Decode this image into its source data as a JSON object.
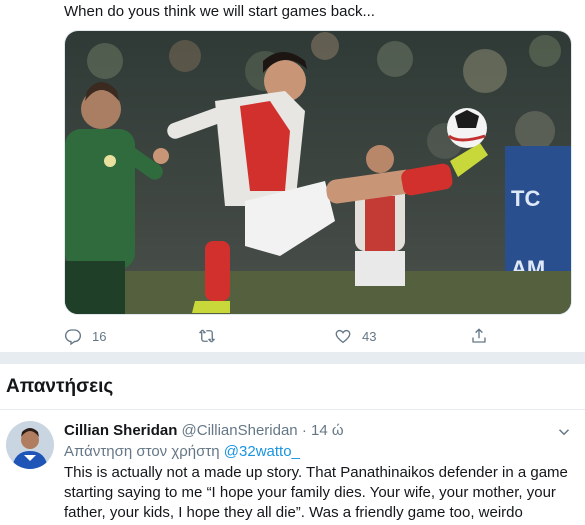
{
  "tweet": {
    "text": "When do yous think we will start games back...",
    "image_alt": "",
    "actions": {
      "reply_count": "16",
      "like_count": "43"
    }
  },
  "replies": {
    "heading": "Απαντήσεις",
    "items": [
      {
        "name": "Cillian Sheridan",
        "handle": "@CillianSheridan",
        "separator": "·",
        "time": "14 ώ",
        "reply_to_prefix": "Απάντηση στον χρήστη",
        "reply_to_handle": "@32watto_",
        "text": "This is actually not a made up story. That Panathinaikos defender in a game starting saying to me “I hope your family dies. Your wife, your mother, your father, your kids, I hope they all die”. Was a friendly game too, weirdo"
      }
    ]
  },
  "icons": {
    "reply": "reply-icon",
    "retweet": "retweet-icon",
    "like": "heart-icon",
    "share": "share-icon",
    "more": "chevron-down-icon"
  },
  "colors": {
    "text": "#14171a",
    "muted": "#657786",
    "link": "#1b95e0",
    "divider": "#e6ecf0"
  }
}
